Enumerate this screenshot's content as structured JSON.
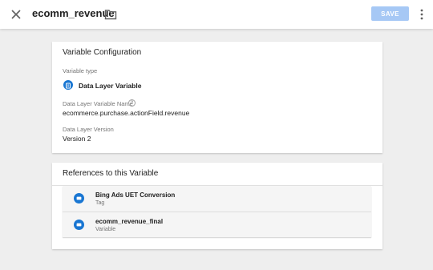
{
  "header": {
    "title": "ecomm_revenue",
    "save_label": "SAVE",
    "close_icon": "close-icon",
    "folder_icon": "folder-icon",
    "more_icon": "more-vert-icon"
  },
  "variable_configuration": {
    "title": "Variable Configuration",
    "variable_type_label": "Variable type",
    "variable_type_value": "Data Layer Variable",
    "variable_type_icon": "data-layer-variable-icon",
    "dlv_name_label": "Data Layer Variable Name",
    "dlv_name_value": "ecommerce.purchase.actionField.revenue",
    "dlv_version_label": "Data Layer Version",
    "dlv_version_value": "Version 2",
    "help_glyph": "?"
  },
  "references": {
    "title": "References to this Variable",
    "items": [
      {
        "name": "Bing Ads UET Conversion",
        "type": "Tag",
        "icon": "tag-icon"
      },
      {
        "name": "ecomm_revenue_final",
        "type": "Variable",
        "icon": "variable-icon"
      }
    ]
  },
  "colors": {
    "accent": "#1976d2",
    "save_disabled": "#a6c8f5",
    "background": "#eeeeee"
  }
}
